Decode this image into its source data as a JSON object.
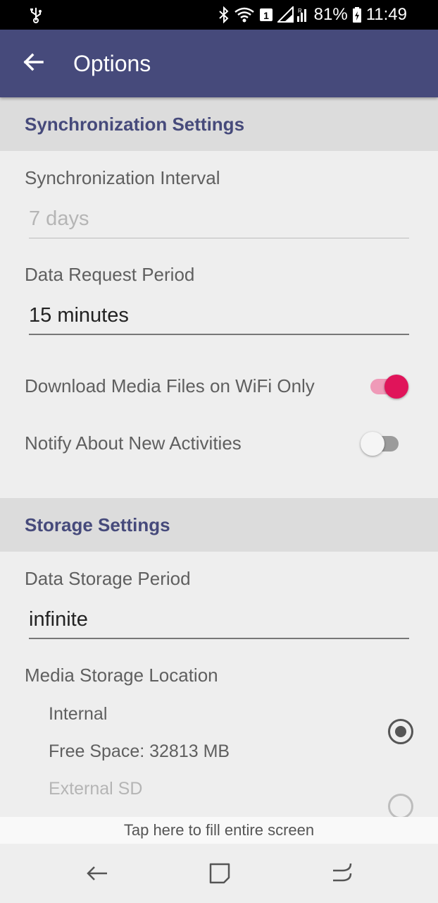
{
  "status_bar": {
    "battery": "81%",
    "time": "11:49",
    "icons": [
      "usb-icon",
      "bluetooth-icon",
      "wifi-icon",
      "sim-1-icon",
      "signal-icon",
      "battery-icon"
    ]
  },
  "app_bar": {
    "title": "Options",
    "back_icon": "arrow-left-icon",
    "color": "#464a7b"
  },
  "sync_section": {
    "title": "Synchronization Settings",
    "interval_label": "Synchronization Interval",
    "interval_value": "7 days",
    "request_label": "Data Request Period",
    "request_value": "15 minutes",
    "wifi_only_label": "Download Media Files on WiFi Only",
    "wifi_only_on": true,
    "notify_label": "Notify About New Activities",
    "notify_on": false
  },
  "storage_section": {
    "title": "Storage Settings",
    "period_label": "Data Storage Period",
    "period_value": "infinite",
    "location_label": "Media Storage Location",
    "options": [
      {
        "name": "Internal",
        "detail": "Free Space: 32813 MB",
        "selected": true,
        "enabled": true
      },
      {
        "name": "External SD",
        "selected": false,
        "enabled": false
      }
    ]
  },
  "banner": {
    "text": "Tap here to fill entire screen"
  },
  "nav_bar": {
    "icons": [
      "back-nav-icon",
      "recents-icon",
      "home-icon"
    ]
  },
  "colors": {
    "accent": "#e0145a",
    "header_bg": "#dcdcdc",
    "background": "#eeeeee"
  }
}
